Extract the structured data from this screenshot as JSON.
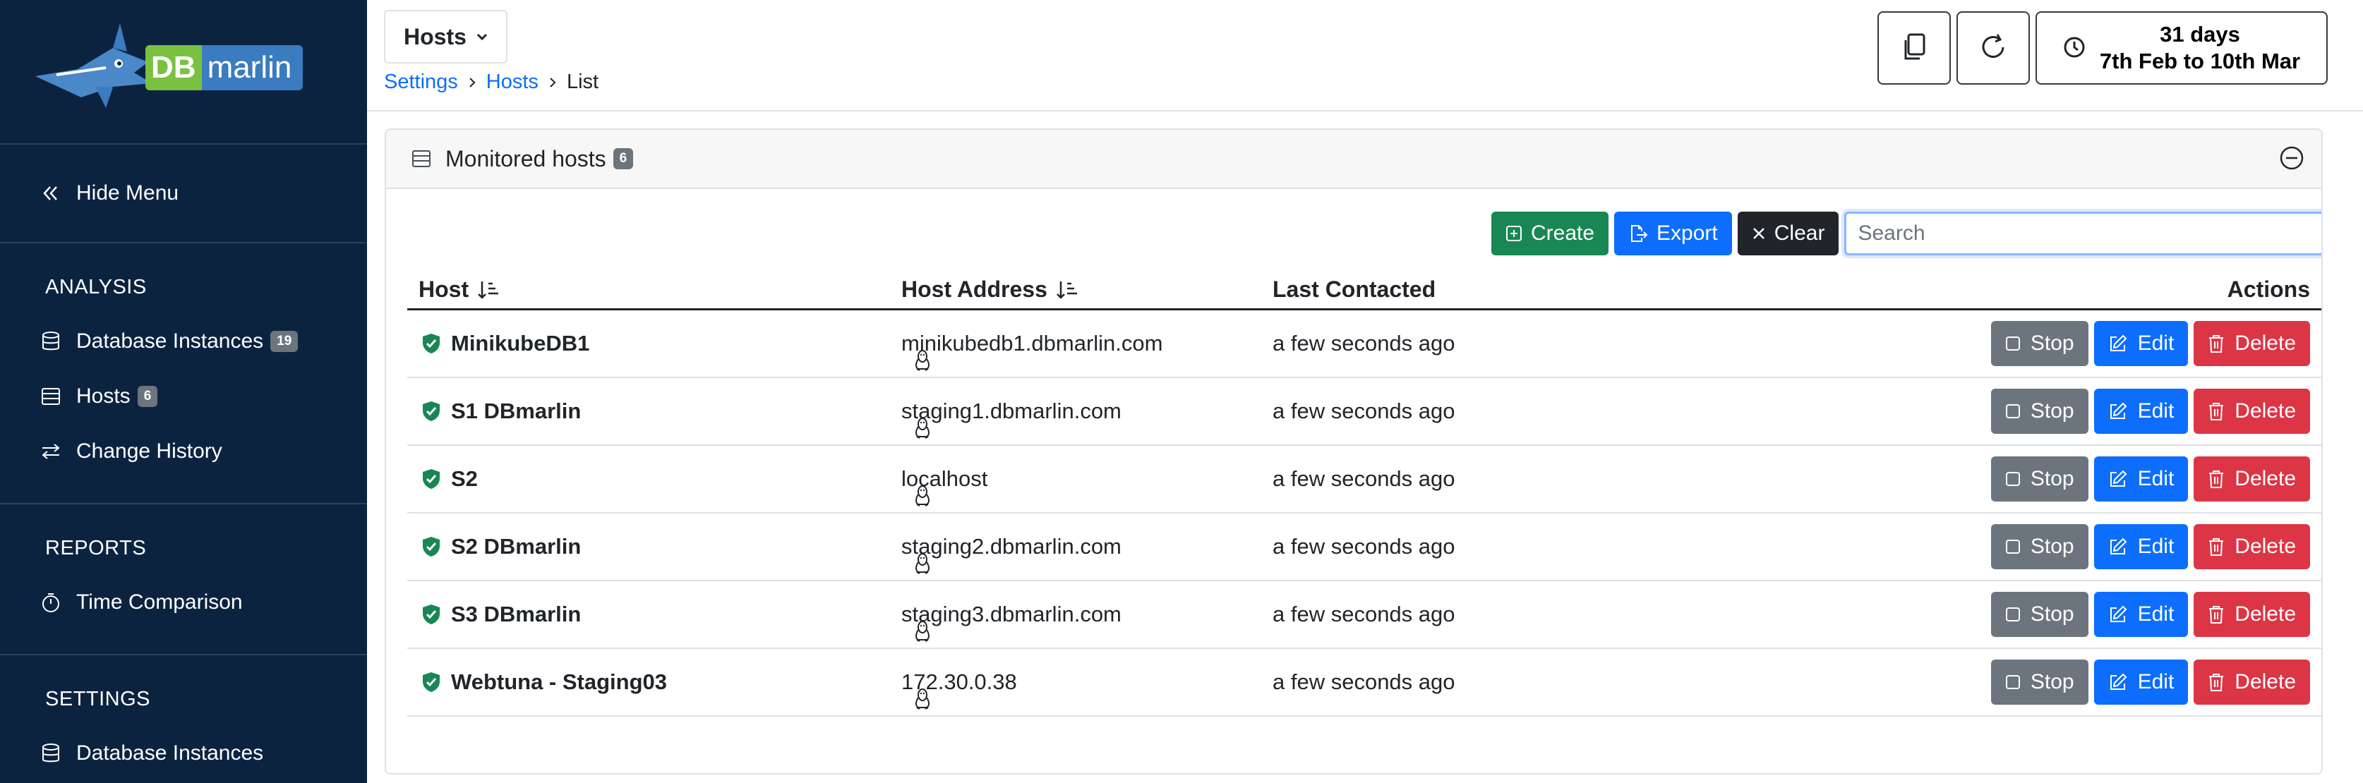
{
  "sidebar": {
    "logo": {
      "db": "DB",
      "marlin": "marlin"
    },
    "hide_menu": "Hide Menu",
    "sections": [
      {
        "title": "ANALYSIS",
        "items": [
          {
            "label": "Database Instances",
            "badge": "19",
            "icon": "database-icon"
          },
          {
            "label": "Hosts",
            "badge": "6",
            "icon": "server-icon"
          },
          {
            "label": "Change History",
            "icon": "arrows-exchange-icon"
          }
        ]
      },
      {
        "title": "REPORTS",
        "items": [
          {
            "label": "Time Comparison",
            "icon": "stopwatch-icon"
          }
        ]
      },
      {
        "title": "SETTINGS",
        "items": [
          {
            "label": "Database Instances",
            "icon": "database-icon"
          }
        ]
      }
    ]
  },
  "header": {
    "dropdown_label": "Hosts",
    "breadcrumb": [
      "Settings",
      "Hosts",
      "List"
    ],
    "time_range": {
      "line1": "31 days",
      "line2": "7th Feb to 10th Mar"
    }
  },
  "card": {
    "title": "Monitored hosts",
    "count": "6",
    "toolbar": {
      "create": "Create",
      "export": "Export",
      "clear": "Clear",
      "search_placeholder": "Search",
      "search_value": ""
    },
    "columns": {
      "host": "Host",
      "address": "Host Address",
      "last": "Last Contacted",
      "actions": "Actions"
    },
    "actions": {
      "stop": "Stop",
      "edit": "Edit",
      "delete": "Delete"
    },
    "rows": [
      {
        "host": "MinikubeDB1",
        "address": "minikubedb1.dbmarlin.com",
        "last": "a few seconds ago"
      },
      {
        "host": "S1 DBmarlin",
        "address": "staging1.dbmarlin.com",
        "last": "a few seconds ago"
      },
      {
        "host": "S2",
        "address": "localhost",
        "last": "a few seconds ago"
      },
      {
        "host": "S2 DBmarlin",
        "address": "staging2.dbmarlin.com",
        "last": "a few seconds ago"
      },
      {
        "host": "S3 DBmarlin",
        "address": "staging3.dbmarlin.com",
        "last": "a few seconds ago"
      },
      {
        "host": "Webtuna - Staging03",
        "address": "172.30.0.38",
        "last": "a few seconds ago"
      }
    ]
  },
  "colors": {
    "sidebar_bg": "#0c2340",
    "success": "#198754",
    "primary": "#0d6efd",
    "danger": "#dc3545",
    "secondary": "#6c757d",
    "dark": "#212529"
  }
}
